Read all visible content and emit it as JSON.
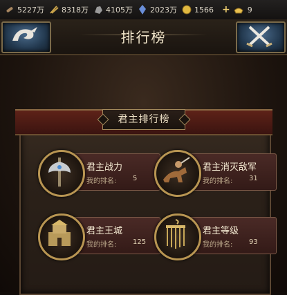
{
  "resources": [
    {
      "icon": "wood-icon",
      "value": "5227万"
    },
    {
      "icon": "food-icon",
      "value": "8318万"
    },
    {
      "icon": "stone-icon",
      "value": "4105万"
    },
    {
      "icon": "crystal-icon",
      "value": "2023万"
    },
    {
      "icon": "coin-icon",
      "value": "1566"
    }
  ],
  "gold_ingot": {
    "icon": "gold-ingot-icon",
    "value": "9"
  },
  "header": {
    "title": "排行榜"
  },
  "panel": {
    "title": "君主排行榜"
  },
  "rankings": [
    {
      "name": "君主战力",
      "rank_label": "我的排名:",
      "rank_value": "5",
      "icon": "axe-icon"
    },
    {
      "name": "君主消灭敌军",
      "rank_label": "我的排名:",
      "rank_value": "31",
      "icon": "cavalry-icon"
    },
    {
      "name": "君主王城",
      "rank_label": "我的排名:",
      "rank_value": "125",
      "icon": "castle-icon"
    },
    {
      "name": "君主等级",
      "rank_label": "我的排名:",
      "rank_value": "93",
      "icon": "banner-icon"
    }
  ],
  "colors": {
    "gold": "#b89552",
    "card_bg": "#3d211d",
    "title_text": "#f3e7cc"
  }
}
